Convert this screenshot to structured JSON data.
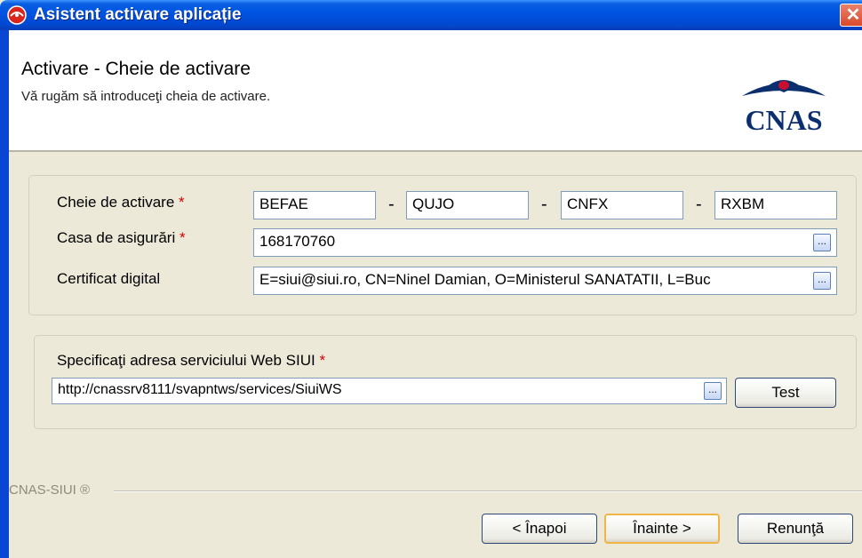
{
  "window": {
    "title": "Asistent activare aplicație"
  },
  "header": {
    "title": "Activare - Cheie de activare",
    "subtitle": "Vă rugăm să introduceţi cheia de activare.",
    "logo_text": "CNAS"
  },
  "activation": {
    "key_label": "Cheie de activare",
    "key_parts": [
      "BEFAE",
      "QUJO",
      "CNFX",
      "RXBM"
    ],
    "separator": "-",
    "casa_label": "Casa de asigurări",
    "casa_value": "168170760",
    "cert_label": "Certificat digital",
    "cert_value": "E=siui@siui.ro, CN=Ninel Damian, O=Ministerul SANATATII, L=Buc",
    "required_mark": "*",
    "browse_label": "..."
  },
  "webservice": {
    "label": "Specificaţi adresa serviciului Web SIUI",
    "url_value": "http://cnassrv8111/svapntws/services/SiuiWS",
    "test_label": "Test"
  },
  "footer": {
    "brand": "CNAS-SIUI ®",
    "back_label": "< Înapoi",
    "next_label": "Înainte >",
    "cancel_label": "Renunţă"
  }
}
